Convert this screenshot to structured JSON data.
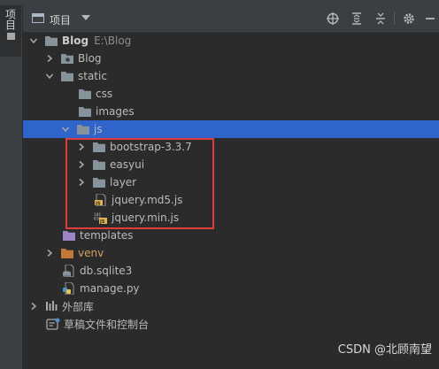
{
  "toolbar": {
    "title": "项目"
  },
  "side_tab": {
    "label": "项目"
  },
  "tree": [
    {
      "label": "Blog",
      "sub": "E:\\Blog",
      "bold": true,
      "indent": 0,
      "arrow": "down",
      "icon": "folder-icon"
    },
    {
      "label": "Blog",
      "indent": 1,
      "arrow": "right",
      "icon": "package-folder-icon"
    },
    {
      "label": "static",
      "indent": 1,
      "arrow": "down",
      "icon": "folder-icon"
    },
    {
      "label": "css",
      "indent": 2,
      "arrow": "none",
      "icon": "folder-icon"
    },
    {
      "label": "images",
      "indent": 2,
      "arrow": "none",
      "icon": "folder-icon"
    },
    {
      "label": "js",
      "indent": 2,
      "arrow": "down",
      "icon": "folder-icon",
      "selected": true
    },
    {
      "label": "bootstrap-3.3.7",
      "indent": 3,
      "arrow": "right",
      "icon": "folder-icon"
    },
    {
      "label": "easyui",
      "indent": 3,
      "arrow": "right",
      "icon": "folder-icon"
    },
    {
      "label": "layer",
      "indent": 3,
      "arrow": "right",
      "icon": "folder-icon"
    },
    {
      "label": "jquery.md5.js",
      "indent": 3,
      "arrow": "none",
      "icon": "js-file-icon"
    },
    {
      "label": "jquery.min.js",
      "indent": 3,
      "arrow": "none",
      "icon": "minified-js-file-icon"
    },
    {
      "label": "templates",
      "indent": 1,
      "arrow": "none",
      "icon": "templates-folder-icon"
    },
    {
      "label": "venv",
      "indent": 1,
      "arrow": "right",
      "icon": "venv-folder-icon",
      "orange": true
    },
    {
      "label": "db.sqlite3",
      "indent": 1,
      "arrow": "none",
      "icon": "database-file-icon"
    },
    {
      "label": "manage.py",
      "indent": 1,
      "arrow": "none",
      "icon": "python-file-icon"
    },
    {
      "label": "外部库",
      "indent": 0,
      "arrow": "right",
      "icon": "library-icon"
    },
    {
      "label": "草稿文件和控制台",
      "indent": 0,
      "arrow": "none",
      "icon": "scratches-icon"
    }
  ],
  "watermark": "CSDN @北顾南望"
}
